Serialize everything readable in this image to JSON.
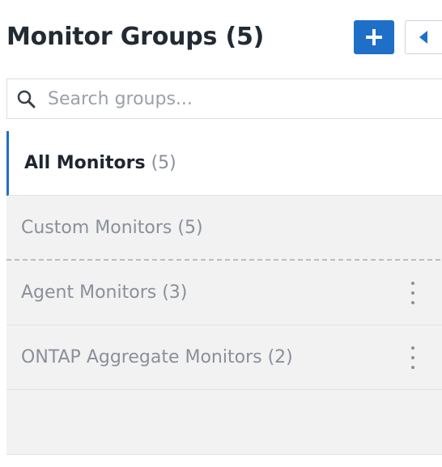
{
  "header": {
    "title": "Monitor Groups",
    "count": "(5)",
    "add_icon": "plus-icon",
    "collapse_icon": "caret-left-icon"
  },
  "search": {
    "placeholder": "Search groups...",
    "value": "",
    "icon": "search-icon"
  },
  "groups": [
    {
      "name": "All Monitors",
      "count": "(5)",
      "active": true
    },
    {
      "name": "Custom Monitors",
      "count": "(5)"
    },
    {
      "name": "Agent Monitors",
      "count": "(3)",
      "menu_icon": "kebab-menu-icon"
    },
    {
      "name": "ONTAP Aggregate Monitors",
      "count": "(2)",
      "menu_icon": "kebab-menu-icon"
    }
  ],
  "colors": {
    "accent": "#1f6fc8",
    "row_background": "#f2f2f2",
    "muted_text": "#8a9099"
  }
}
